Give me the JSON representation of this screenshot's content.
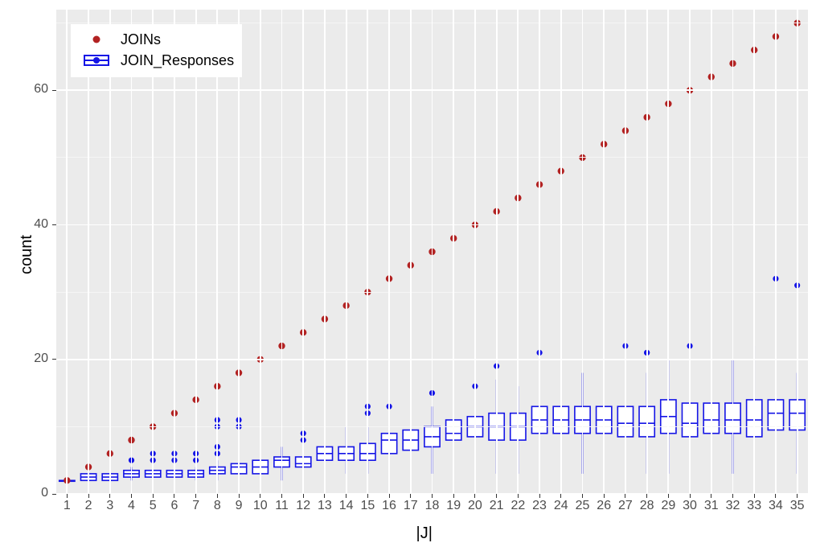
{
  "chart_data": {
    "type": "boxplot_with_points",
    "xlabel": "|J|",
    "ylabel": "count",
    "xlim": [
      0.5,
      35.5
    ],
    "ylim": [
      0,
      72
    ],
    "y_breaks": [
      0,
      20,
      40,
      60
    ],
    "x_breaks": [
      1,
      2,
      3,
      4,
      5,
      6,
      7,
      8,
      9,
      10,
      11,
      12,
      13,
      14,
      15,
      16,
      17,
      18,
      19,
      20,
      21,
      22,
      23,
      24,
      25,
      26,
      27,
      28,
      29,
      30,
      31,
      32,
      33,
      34,
      35
    ],
    "series": [
      {
        "name": "JOINs",
        "type": "point",
        "color": "#b22222",
        "x": [
          1,
          2,
          3,
          4,
          5,
          6,
          7,
          8,
          9,
          10,
          11,
          12,
          13,
          14,
          15,
          16,
          17,
          18,
          19,
          20,
          21,
          22,
          23,
          24,
          25,
          26,
          27,
          28,
          29,
          30,
          31,
          32,
          33,
          34,
          35
        ],
        "y": [
          2,
          4,
          6,
          8,
          10,
          12,
          14,
          16,
          18,
          20,
          22,
          24,
          26,
          28,
          30,
          32,
          34,
          36,
          38,
          40,
          42,
          44,
          46,
          48,
          50,
          52,
          54,
          56,
          58,
          60,
          62,
          64,
          66,
          68,
          70
        ]
      },
      {
        "name": "JOIN_Responses",
        "type": "boxplot",
        "color": "#1414e6",
        "categories": [
          1,
          2,
          3,
          4,
          5,
          6,
          7,
          8,
          9,
          10,
          11,
          12,
          13,
          14,
          15,
          16,
          17,
          18,
          19,
          20,
          21,
          22,
          23,
          24,
          25,
          26,
          27,
          28,
          29,
          30,
          31,
          32,
          33,
          34,
          35
        ],
        "boxes": [
          {
            "low": 2,
            "q1": 2,
            "med": 2,
            "q3": 2,
            "high": 2,
            "out": []
          },
          {
            "low": 2,
            "q1": 2,
            "med": 2.5,
            "q3": 3,
            "high": 3,
            "out": []
          },
          {
            "low": 2,
            "q1": 2,
            "med": 2.5,
            "q3": 3,
            "high": 4,
            "out": []
          },
          {
            "low": 2,
            "q1": 2.5,
            "med": 3,
            "q3": 3.5,
            "high": 4,
            "out": [
              5
            ]
          },
          {
            "low": 2,
            "q1": 2.5,
            "med": 3,
            "q3": 3.5,
            "high": 4,
            "out": [
              5,
              6
            ]
          },
          {
            "low": 2,
            "q1": 2.5,
            "med": 3,
            "q3": 3.5,
            "high": 4,
            "out": [
              5,
              6
            ]
          },
          {
            "low": 2,
            "q1": 2.5,
            "med": 3,
            "q3": 3.5,
            "high": 4,
            "out": [
              5,
              6
            ]
          },
          {
            "low": 2,
            "q1": 3,
            "med": 3.5,
            "q3": 4,
            "high": 5,
            "out": [
              6,
              7,
              10,
              11
            ]
          },
          {
            "low": 2,
            "q1": 3,
            "med": 4,
            "q3": 4.5,
            "high": 6,
            "out": [
              10,
              11
            ]
          },
          {
            "low": 2,
            "q1": 3,
            "med": 4,
            "q3": 5,
            "high": 7,
            "out": []
          },
          {
            "low": 2,
            "q1": 4,
            "med": 5,
            "q3": 5.5,
            "high": 7,
            "out": []
          },
          {
            "low": 2,
            "q1": 4,
            "med": 4.5,
            "q3": 5.5,
            "high": 7,
            "out": [
              8,
              9
            ]
          },
          {
            "low": 3,
            "q1": 5,
            "med": 6,
            "q3": 7,
            "high": 9,
            "out": []
          },
          {
            "low": 3,
            "q1": 5,
            "med": 6,
            "q3": 7,
            "high": 10,
            "out": []
          },
          {
            "low": 3,
            "q1": 5,
            "med": 6,
            "q3": 7.5,
            "high": 10,
            "out": [
              12,
              13
            ]
          },
          {
            "low": 3,
            "q1": 6,
            "med": 8,
            "q3": 9,
            "high": 12,
            "out": [
              13
            ]
          },
          {
            "low": 3,
            "q1": 6.5,
            "med": 8,
            "q3": 9.5,
            "high": 13,
            "out": []
          },
          {
            "low": 3,
            "q1": 7,
            "med": 8.5,
            "q3": 10,
            "high": 13,
            "out": [
              15
            ]
          },
          {
            "low": 4,
            "q1": 8,
            "med": 9,
            "q3": 11,
            "high": 14,
            "out": []
          },
          {
            "low": 4,
            "q1": 8.5,
            "med": 10,
            "q3": 11.5,
            "high": 15,
            "out": [
              16
            ]
          },
          {
            "low": 3,
            "q1": 8,
            "med": 10,
            "q3": 12,
            "high": 17,
            "out": [
              19
            ]
          },
          {
            "low": 3,
            "q1": 8,
            "med": 10,
            "q3": 12,
            "high": 16,
            "out": []
          },
          {
            "low": 3,
            "q1": 9,
            "med": 11,
            "q3": 13,
            "high": 18,
            "out": [
              21
            ]
          },
          {
            "low": 3,
            "q1": 9,
            "med": 11,
            "q3": 13,
            "high": 18,
            "out": []
          },
          {
            "low": 3,
            "q1": 9,
            "med": 11,
            "q3": 13,
            "high": 18,
            "out": []
          },
          {
            "low": 3,
            "q1": 9,
            "med": 11,
            "q3": 13,
            "high": 18,
            "out": []
          },
          {
            "low": 3,
            "q1": 8.5,
            "med": 10.5,
            "q3": 13,
            "high": 19,
            "out": [
              22
            ]
          },
          {
            "low": 3,
            "q1": 8.5,
            "med": 10.5,
            "q3": 13,
            "high": 18,
            "out": [
              21,
              21
            ]
          },
          {
            "low": 3,
            "q1": 9,
            "med": 11.5,
            "q3": 14,
            "high": 20,
            "out": []
          },
          {
            "low": 3,
            "q1": 8.5,
            "med": 10.5,
            "q3": 13.5,
            "high": 19,
            "out": [
              22
            ]
          },
          {
            "low": 3,
            "q1": 9,
            "med": 11,
            "q3": 13.5,
            "high": 19,
            "out": []
          },
          {
            "low": 3,
            "q1": 9,
            "med": 11,
            "q3": 13.5,
            "high": 20,
            "out": []
          },
          {
            "low": 3,
            "q1": 8.5,
            "med": 11,
            "q3": 14,
            "high": 22,
            "out": []
          },
          {
            "low": 3,
            "q1": 9.5,
            "med": 12,
            "q3": 14,
            "high": 20,
            "out": [
              32
            ]
          },
          {
            "low": 3,
            "q1": 9.5,
            "med": 12,
            "q3": 14,
            "high": 18,
            "out": [
              31
            ]
          }
        ]
      }
    ],
    "legend": {
      "position": "top-left"
    }
  },
  "colors": {
    "joins": "#b22222",
    "join_responses": "#1414e6",
    "panel_bg": "#ebebeb",
    "grid_major": "#ffffff"
  },
  "legend_items": [
    {
      "label": "JOINs",
      "type": "point",
      "color": "#b22222"
    },
    {
      "label": "JOIN_Responses",
      "type": "box",
      "color": "#1414e6"
    }
  ]
}
